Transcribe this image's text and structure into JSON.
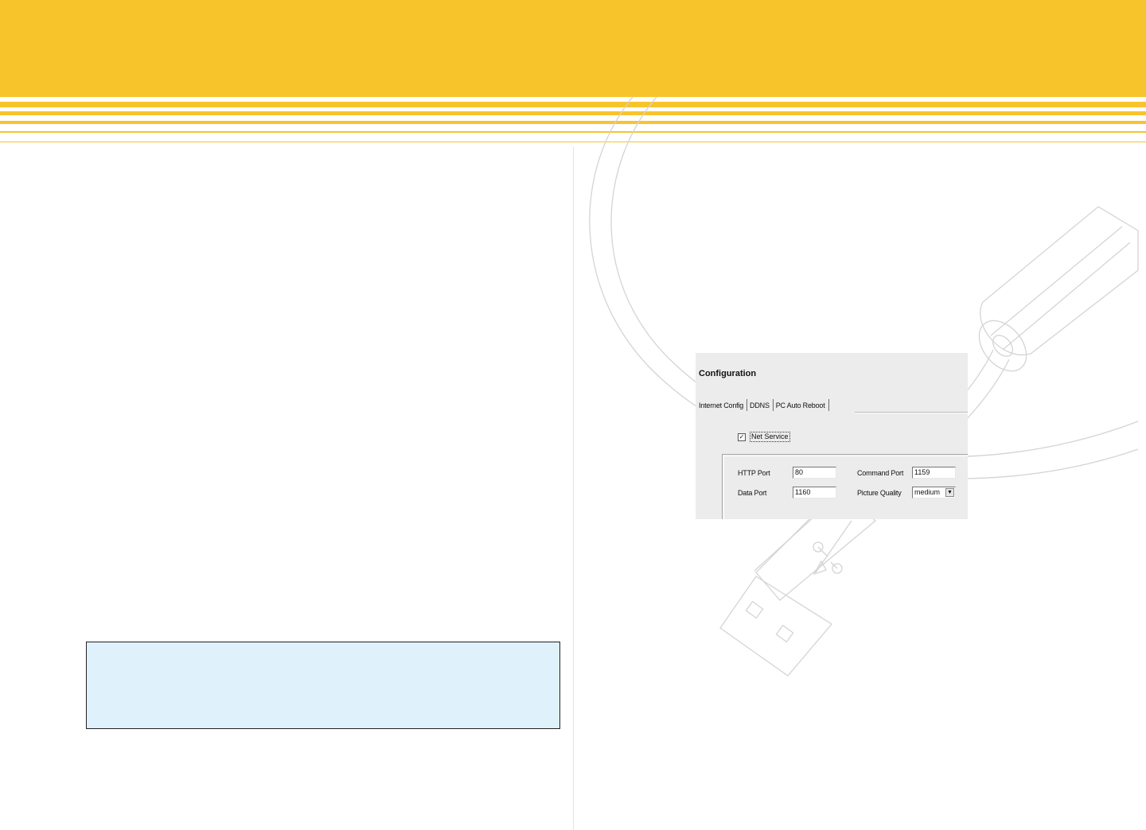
{
  "config": {
    "title": "Configuration",
    "tabs": [
      {
        "label": "Internet Config",
        "active": true
      },
      {
        "label": "DDNS",
        "active": false
      },
      {
        "label": "PC Auto Reboot",
        "active": false
      }
    ],
    "net_service": {
      "label": "Net Service",
      "checked": true,
      "check_glyph": "✓"
    },
    "fields": {
      "http_port": {
        "label": "HTTP Port",
        "value": "80"
      },
      "command_port": {
        "label": "Command Port",
        "value": "1159"
      },
      "data_port": {
        "label": "Data Port",
        "value": "1160"
      },
      "picture_quality": {
        "label": "Picture Quality",
        "value": "medium",
        "arrow": "▼"
      }
    }
  },
  "colors": {
    "header": "#f8c42c",
    "note_box_fill": "#dff1fb",
    "graphic_stroke": "#d4d4d4"
  },
  "icons": {
    "background_graphic": "usb-cable-icon",
    "usb_symbol": "usb-symbol-icon"
  }
}
